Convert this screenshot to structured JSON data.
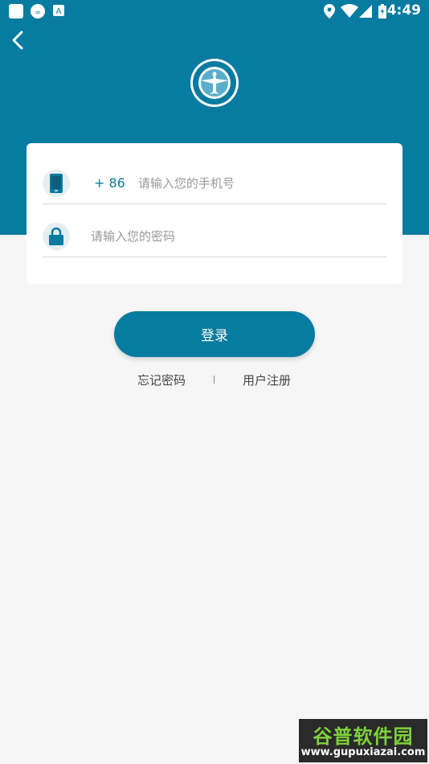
{
  "status_bar": {
    "time": "4:49",
    "left_icons": [
      "app-square-icon",
      "infinity-icon",
      "a-letter-icon"
    ],
    "right_icons": [
      "location-icon",
      "wifi-icon",
      "signal-icon",
      "battery-icon"
    ]
  },
  "header": {
    "back_icon": "chevron-left-icon",
    "logo_icon": "emblem-logo-icon",
    "bg_color": "#087ba0"
  },
  "login_form": {
    "phone": {
      "icon": "phone-icon",
      "country_code": "+ 86",
      "placeholder": "请输入您的手机号",
      "value": ""
    },
    "password": {
      "icon": "lock-icon",
      "placeholder": "请输入您的密码",
      "value": ""
    },
    "login_label": "登录"
  },
  "links": {
    "forgot_password": "忘记密码",
    "register": "用户注册"
  },
  "watermark": {
    "title": "谷普软件园",
    "url": "www.gupuxiazai.com"
  },
  "colors": {
    "accent": "#087ba0",
    "background": "#f6f6f6",
    "card": "#ffffff"
  }
}
